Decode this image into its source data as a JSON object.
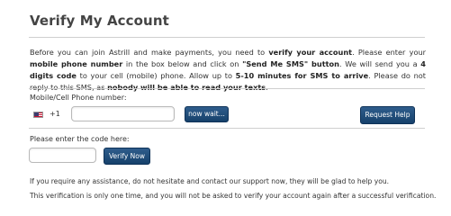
{
  "page": {
    "title": "Verify My Account"
  },
  "intro": {
    "t1": "Before you can join Astrill and make payments, you need to ",
    "b1": "verify your account",
    "t2": ". Please enter your ",
    "b2": "mobile phone number",
    "t3": " in the box below and click on ",
    "b3": "\"Send Me SMS\" button",
    "t4": ". We will send you a ",
    "b4": "4 digits code",
    "t5": " to your cell (mobile) phone. Allow up to ",
    "b5": "5-10 minutes for SMS to arrive",
    "t6": ". Please do not reply to this SMS, as ",
    "b6": "nobody will be able to read your texts",
    "t7": "."
  },
  "phone": {
    "label": "Mobile/Cell Phone number:",
    "flag_icon": "us-flag-icon",
    "country_code": "+1",
    "value": "",
    "send_button": "now wait...",
    "help_button": "Request Help"
  },
  "code": {
    "label": "Please enter the code here:",
    "value": "",
    "verify_button": "Verify Now"
  },
  "notes": {
    "support": "If you require any assistance, do not hesitate and contact our support now, they will be glad to help you.",
    "one_time": "This verification is only one time, and you will not be asked to verify your account again after a successful verification."
  },
  "colors": {
    "button_bg": "#1f4e7a",
    "divider": "#cfcfcf",
    "text": "#333333"
  }
}
